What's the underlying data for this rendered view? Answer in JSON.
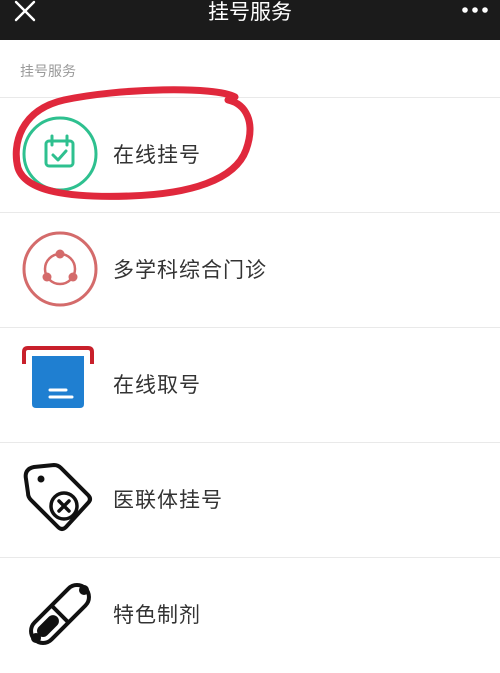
{
  "header": {
    "title": "挂号服务",
    "close_icon": "close-icon",
    "more_icon": "more-icon"
  },
  "section": {
    "label": "挂号服务"
  },
  "items": [
    {
      "label": "在线挂号",
      "icon": "calendar-check-icon",
      "color": "#2ec08f"
    },
    {
      "label": "多学科综合门诊",
      "icon": "share-nodes-icon",
      "color": "#d46b6b"
    },
    {
      "label": "在线取号",
      "icon": "ticket-dispenser-icon",
      "color": "#1f7fd1"
    },
    {
      "label": "医联体挂号",
      "icon": "tag-x-icon",
      "color": "#111111"
    },
    {
      "label": "特色制剂",
      "icon": "pill-icon",
      "color": "#111111"
    }
  ],
  "colors": {
    "header_bg": "#1b1b1b",
    "annotation_red": "#e0283c"
  }
}
